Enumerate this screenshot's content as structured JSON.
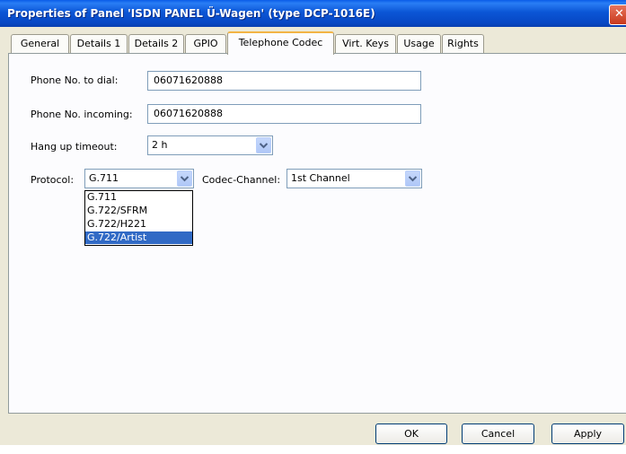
{
  "window": {
    "title": "Properties of Panel 'ISDN PANEL Ü-Wagen' (type DCP-1016E)"
  },
  "tabs": [
    {
      "label": "General"
    },
    {
      "label": "Details 1"
    },
    {
      "label": "Details 2"
    },
    {
      "label": "GPIO"
    },
    {
      "label": "Telephone Codec",
      "active": true
    },
    {
      "label": "Virt. Keys"
    },
    {
      "label": "Usage"
    },
    {
      "label": "Rights"
    }
  ],
  "form": {
    "phone_dial_label": "Phone No. to dial:",
    "phone_dial_value": "06071620888",
    "phone_incoming_label": "Phone No. incoming:",
    "phone_incoming_value": "06071620888",
    "hangup_label": "Hang up timeout:",
    "hangup_value": "2 h",
    "protocol_label": "Protocol:",
    "protocol_value": "G.711",
    "protocol_options": [
      "G.711",
      "G.722/SFRM",
      "G.722/H221",
      "G.722/Artist"
    ],
    "protocol_highlighted": "G.722/Artist",
    "codec_channel_label": "Codec-Channel:",
    "codec_channel_value": "1st Channel"
  },
  "buttons": {
    "ok": "OK",
    "cancel": "Cancel",
    "apply": "Apply"
  },
  "colors": {
    "titlebar": "#0b56d6",
    "active_tab_accent": "#f2b445",
    "selection": "#316ac5",
    "dialog_bg": "#ece9d8"
  }
}
